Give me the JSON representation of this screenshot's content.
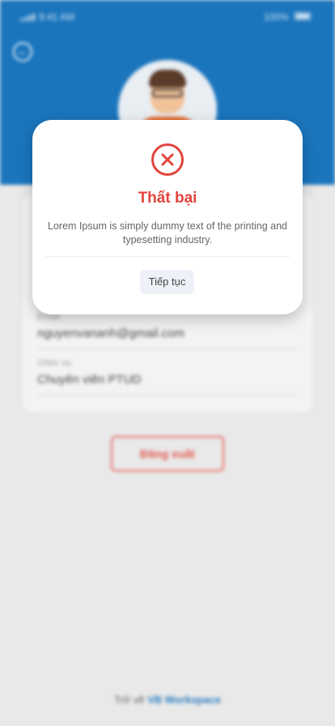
{
  "status_bar": {
    "time": "9:41 AM",
    "battery": "100%"
  },
  "profile": {
    "email_label": "Email",
    "email_value": "nguyenvananh@gmail.com",
    "role_label": "Chức vụ",
    "role_value": "Chuyên viên PTUD"
  },
  "logout_label": "Đăng xuất",
  "footer": {
    "prefix": "Trở về",
    "brand": "VB Workspace"
  },
  "modal": {
    "icon": "error-circle-x-icon",
    "title": "Thất bại",
    "message": "Lorem Ipsum is simply dummy text of the printing and typesetting industry.",
    "button_label": "Tiếp tục"
  },
  "colors": {
    "header": "#1b75bc",
    "error": "#e2453c",
    "logout": "#e2564d",
    "brand_link": "#2e7fc0"
  }
}
